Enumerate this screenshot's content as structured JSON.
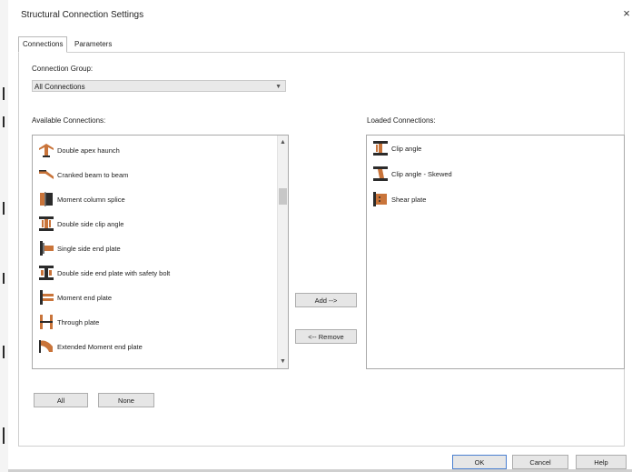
{
  "window": {
    "title": "Structural Connection Settings",
    "close_glyph": "×"
  },
  "tabs": [
    {
      "label": "Connections"
    },
    {
      "label": "Parameters"
    }
  ],
  "connection_group": {
    "label": "Connection Group:",
    "value": "All Connections"
  },
  "available": {
    "label": "Available Connections:",
    "items": [
      {
        "label": "Double apex haunch"
      },
      {
        "label": "Cranked beam to beam"
      },
      {
        "label": "Moment column splice"
      },
      {
        "label": "Double side clip angle"
      },
      {
        "label": "Single side end plate"
      },
      {
        "label": "Double side end plate with safety bolt"
      },
      {
        "label": "Moment end plate"
      },
      {
        "label": "Through plate"
      },
      {
        "label": "Extended Moment end plate"
      }
    ]
  },
  "loaded": {
    "label": "Loaded Connections:",
    "items": [
      {
        "label": "Clip angle"
      },
      {
        "label": "Clip angle - Skewed"
      },
      {
        "label": "Shear plate"
      }
    ]
  },
  "buttons": {
    "add": "Add -->",
    "remove": "<-- Remove",
    "all": "All",
    "none": "None",
    "ok": "OK",
    "cancel": "Cancel",
    "help": "Help"
  },
  "colors": {
    "icon_orange": "#c9743a",
    "icon_dark": "#2b2b2b",
    "default_border": "#4a7fd0"
  }
}
